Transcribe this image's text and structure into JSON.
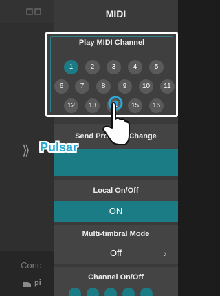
{
  "panel": {
    "title": "MIDI"
  },
  "play_midi_channel": {
    "label": "Play MIDI Channel",
    "channels": [
      "1",
      "2",
      "3",
      "4",
      "5",
      "6",
      "7",
      "8",
      "9",
      "10",
      "11",
      "12",
      "13",
      "14",
      "15",
      "16"
    ],
    "selected": "1"
  },
  "send_program_change": {
    "label": "Send Program Change"
  },
  "local_on_off": {
    "label": "Local On/Off",
    "value": "ON"
  },
  "multi_timbral_mode": {
    "label": "Multi-timbral Mode",
    "value": "Off"
  },
  "channel_on_off": {
    "label": "Channel On/Off"
  },
  "background": {
    "section_label": "Conc",
    "item_label": "pi"
  },
  "overlay": {
    "tap_label": "Pulsar"
  },
  "colors": {
    "accent": "#1c7c86",
    "tap_text": "#29a8d6"
  },
  "icons": [
    "chevron-double-left-icon",
    "chevron-right-icon",
    "piano-icon",
    "tap-hand-icon"
  ]
}
